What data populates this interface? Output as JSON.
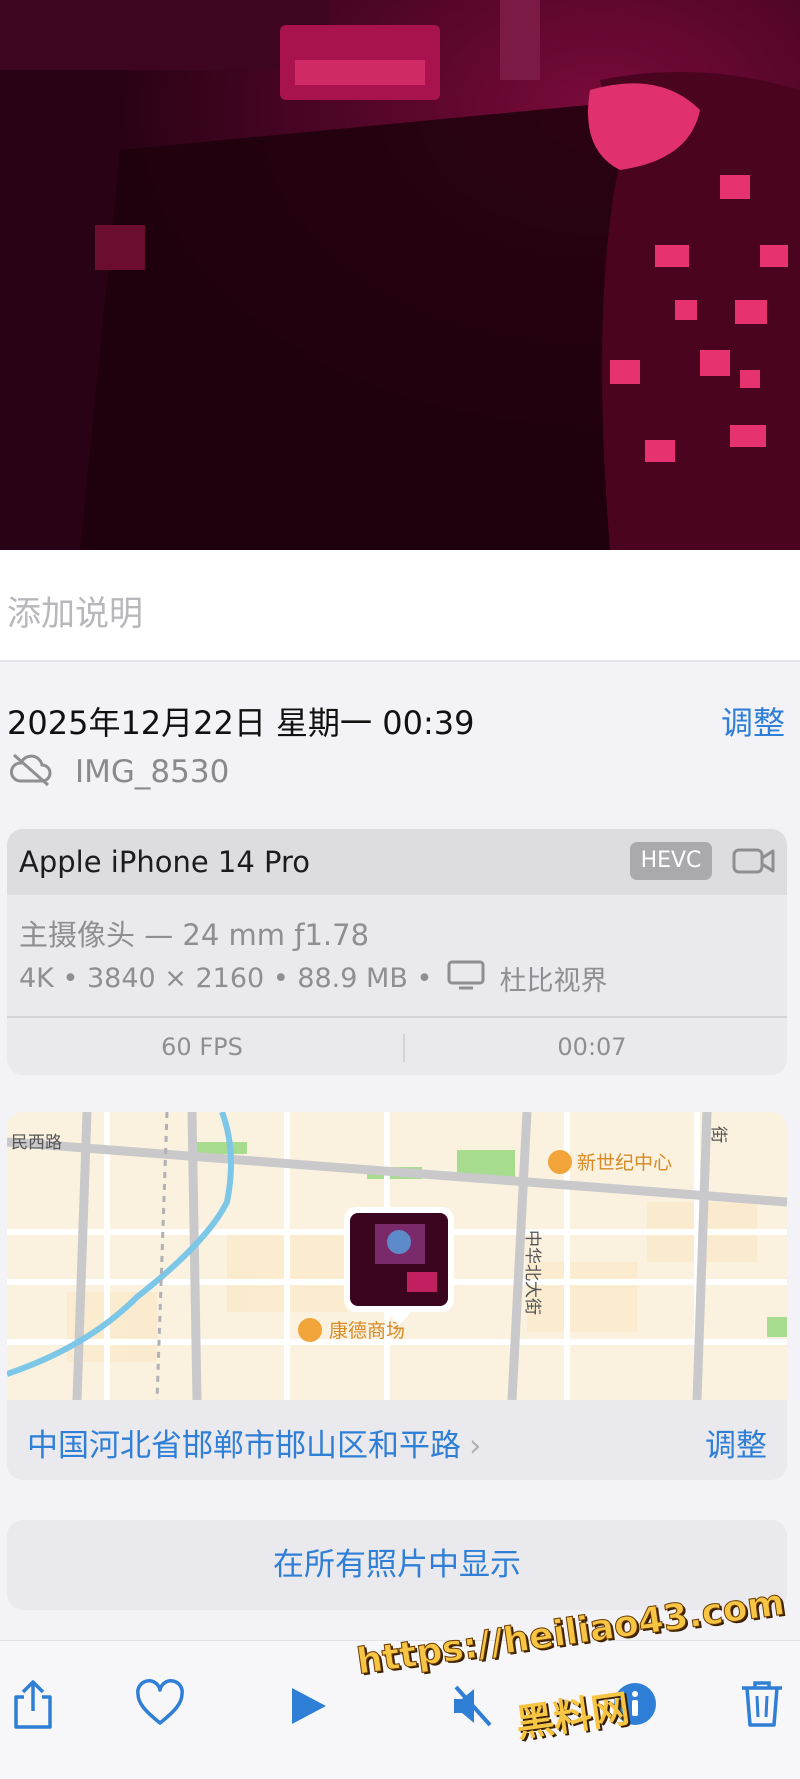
{
  "photo": {
    "description_icon": "photo-preview"
  },
  "caption": {
    "placeholder": "添加说明"
  },
  "info": {
    "date": "2025年12月22日 星期一 00:39",
    "adjust_label": "调整",
    "filename": "IMG_8530"
  },
  "camera_card": {
    "device": "Apple iPhone 14 Pro",
    "codec_badge": "HEVC",
    "lens": "主摄像头 — 24 mm ƒ1.78",
    "resolution": "4K",
    "dimensions": "3840 × 2160",
    "size": "88.9 MB",
    "hdr": "杜比视界",
    "fps": "60 FPS",
    "duration": "00:07"
  },
  "map": {
    "labels": {
      "road_west": "民西路",
      "poi_center": "新世纪中心",
      "street": "中华北大街",
      "poi_mall": "康德商场",
      "corner": "街"
    },
    "address": "中国河北省邯郸市邯山区和平路",
    "adjust_label": "调整"
  },
  "show_all": "在所有照片中显示",
  "watermark": {
    "url": "https://heiliao43.com",
    "name": "黑料网"
  },
  "colors": {
    "accent": "#2f7fd6",
    "background": "#f2f2f7"
  }
}
